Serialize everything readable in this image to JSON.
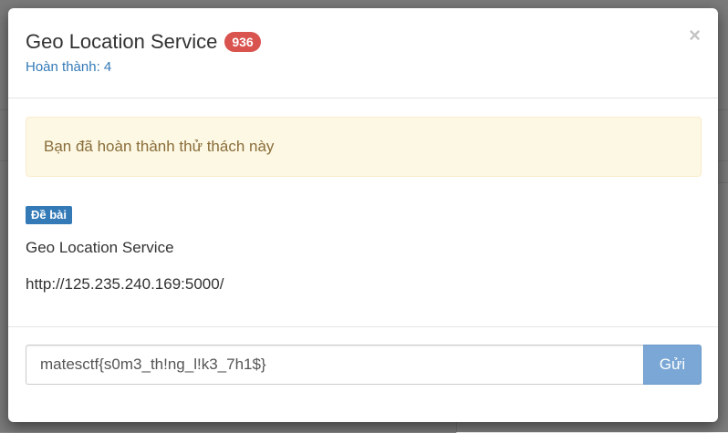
{
  "modal": {
    "title": "Geo Location Service",
    "points_badge": "936",
    "solved_count": "Hoàn thành: 4",
    "close_symbol": "×"
  },
  "alert": {
    "message": "Bạn đã hoàn thành thử thách này"
  },
  "challenge": {
    "section_label": "Đề bài",
    "description": "Geo Location Service",
    "url": "http://125.235.240.169:5000/"
  },
  "submission": {
    "flag_value": "matesctf{s0m3_th!ng_l!k3_7h1$}",
    "submit_label": "Gửi"
  },
  "colors": {
    "badge": "#d9534f",
    "link": "#337ab7",
    "alert_bg": "#fcf8e3",
    "submit_bg": "#7aa7d5"
  }
}
